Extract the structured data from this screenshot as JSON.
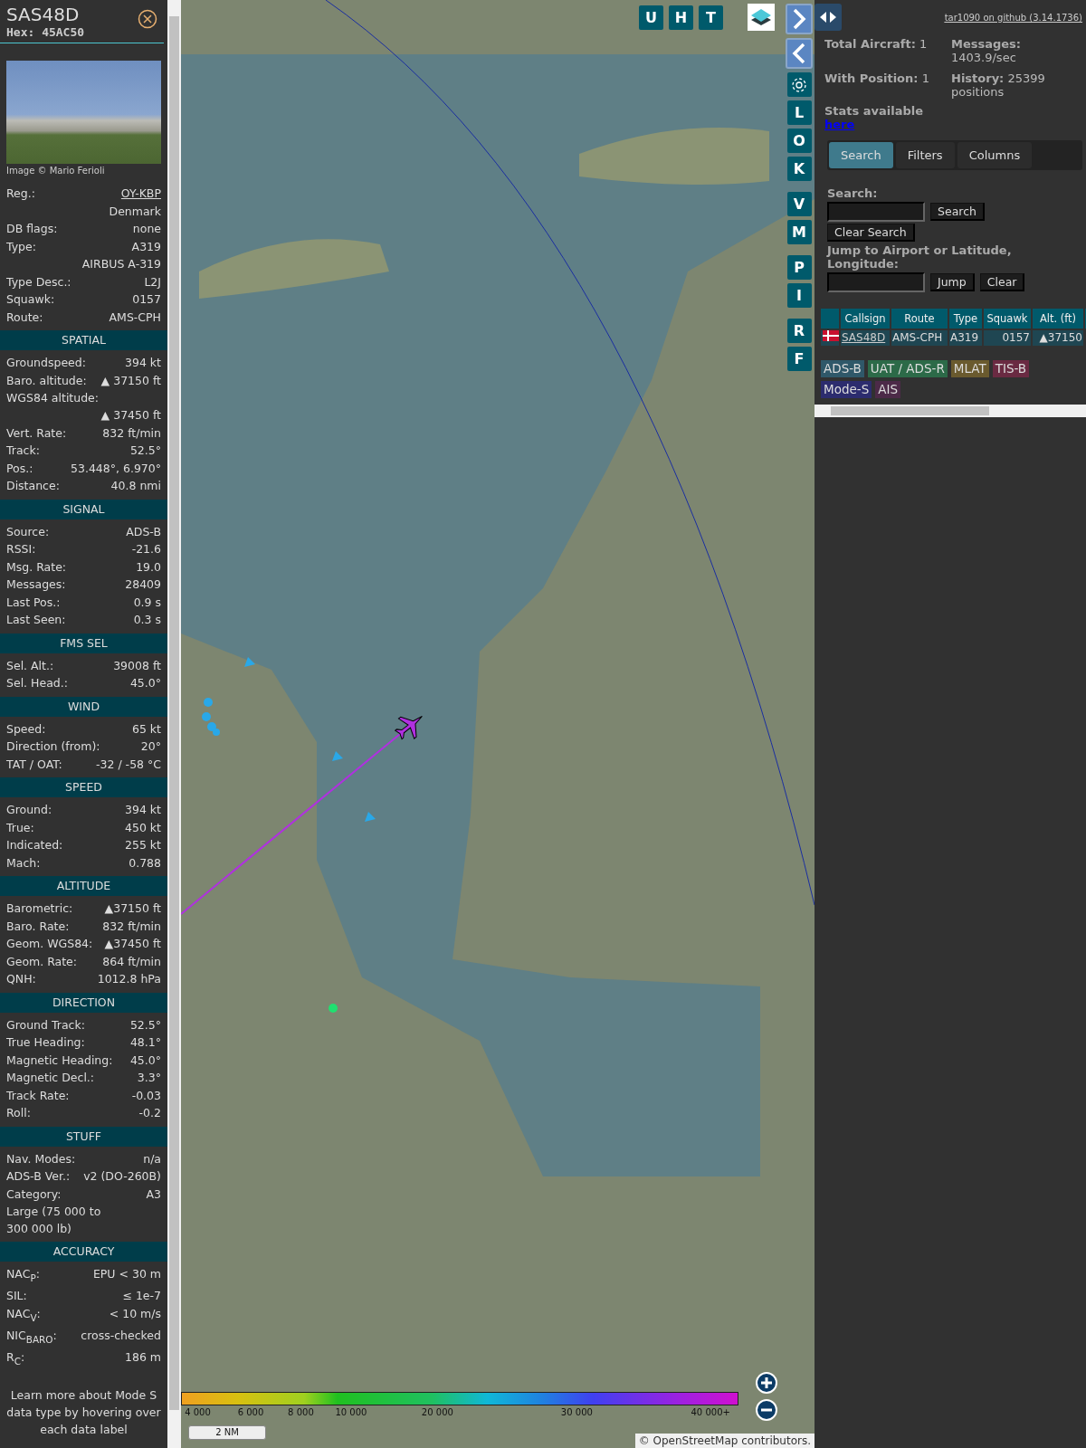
{
  "detail": {
    "callsign": "SAS48D",
    "hex": "Hex: 45AC50",
    "photo_credit": "Image © Mario Ferioli",
    "info_rows": [
      {
        "kind": "link",
        "label": "Reg.:",
        "value": "OY-KBP"
      },
      {
        "kind": "value",
        "value": "Denmark"
      },
      {
        "kind": "pair",
        "label": "DB flags:",
        "value": "none"
      },
      {
        "kind": "pair",
        "label": "Type:",
        "value": "A319"
      },
      {
        "kind": "value",
        "value": "AIRBUS A-319"
      },
      {
        "kind": "pair",
        "label": "Type Desc.:",
        "value": "L2J"
      },
      {
        "kind": "pair",
        "label": "Squawk:",
        "value": "0157"
      },
      {
        "kind": "pair",
        "label": "Route:",
        "value": "AMS-CPH"
      }
    ],
    "sections": [
      {
        "title": "SPATIAL",
        "rows": [
          {
            "kind": "pair",
            "label": "Groundspeed:",
            "value": "394 kt"
          },
          {
            "kind": "pair",
            "label": "Baro. altitude:",
            "value": "▲ 37150 ft"
          },
          {
            "kind": "note",
            "label": "WGS84 altitude:"
          },
          {
            "kind": "value",
            "value": "▲ 37450 ft"
          },
          {
            "kind": "pair",
            "label": "Vert. Rate:",
            "value": "832 ft/min"
          },
          {
            "kind": "pair",
            "label": "Track:",
            "value": "52.5°"
          },
          {
            "kind": "pair",
            "label": "Pos.:",
            "value": "53.448°, 6.970°"
          },
          {
            "kind": "pair",
            "label": "Distance:",
            "value": "40.8 nmi"
          }
        ]
      },
      {
        "title": "SIGNAL",
        "rows": [
          {
            "kind": "pair",
            "label": "Source:",
            "value": "ADS-B"
          },
          {
            "kind": "pair",
            "label": "RSSI:",
            "value": "-21.6"
          },
          {
            "kind": "pair",
            "label": "Msg. Rate:",
            "value": "19.0"
          },
          {
            "kind": "pair",
            "label": "Messages:",
            "value": "28409"
          },
          {
            "kind": "pair",
            "label": "Last Pos.:",
            "value": "0.9 s"
          },
          {
            "kind": "pair",
            "label": "Last Seen:",
            "value": "0.3 s"
          }
        ]
      },
      {
        "title": "FMS SEL",
        "rows": [
          {
            "kind": "pair",
            "label": "Sel. Alt.:",
            "value": "39008 ft"
          },
          {
            "kind": "pair",
            "label": "Sel. Head.:",
            "value": "45.0°"
          }
        ]
      },
      {
        "title": "WIND",
        "rows": [
          {
            "kind": "pair",
            "label": "Speed:",
            "value": "65 kt"
          },
          {
            "kind": "pair",
            "label": "Direction (from):",
            "value": "20°"
          },
          {
            "kind": "pair",
            "label": "TAT / OAT:",
            "value": "-32 / -58 °C"
          }
        ]
      },
      {
        "title": "SPEED",
        "rows": [
          {
            "kind": "pair",
            "label": "Ground:",
            "value": "394 kt"
          },
          {
            "kind": "pair",
            "label": "True:",
            "value": "450 kt"
          },
          {
            "kind": "pair",
            "label": "Indicated:",
            "value": "255 kt"
          },
          {
            "kind": "pair",
            "label": "Mach:",
            "value": "0.788"
          }
        ]
      },
      {
        "title": "ALTITUDE",
        "rows": [
          {
            "kind": "pair",
            "label": "Barometric:",
            "value": "▲37150 ft"
          },
          {
            "kind": "pair",
            "label": "Baro. Rate:",
            "value": "832 ft/min"
          },
          {
            "kind": "pair",
            "label": "Geom. WGS84:",
            "value": "▲37450 ft"
          },
          {
            "kind": "pair",
            "label": "Geom. Rate:",
            "value": "864 ft/min"
          },
          {
            "kind": "pair",
            "label": "QNH:",
            "value": "1012.8 hPa"
          }
        ]
      },
      {
        "title": "DIRECTION",
        "rows": [
          {
            "kind": "pair",
            "label": "Ground Track:",
            "value": "52.5°"
          },
          {
            "kind": "pair",
            "label": "True Heading:",
            "value": "48.1°"
          },
          {
            "kind": "pair",
            "label": "Magnetic Heading:",
            "value": "45.0°"
          },
          {
            "kind": "pair",
            "label": "Magnetic Decl.:",
            "value": "3.3°"
          },
          {
            "kind": "pair",
            "label": "Track Rate:",
            "value": "-0.03"
          },
          {
            "kind": "pair",
            "label": "Roll:",
            "value": "-0.2"
          }
        ]
      },
      {
        "title": "STUFF",
        "rows": [
          {
            "kind": "pair",
            "label": "Nav. Modes:",
            "value": "n/a"
          },
          {
            "kind": "pair",
            "label": "ADS-B Ver.:",
            "value": "v2 (DO-260B)"
          },
          {
            "kind": "pair",
            "label": "Category:",
            "value": "A3"
          },
          {
            "kind": "note",
            "label": "Large (75 000 to 300 000 lb)"
          }
        ]
      },
      {
        "title": "ACCURACY",
        "rows": [
          {
            "kind": "pair",
            "label": "NAC$_{P}$:",
            "value": "EPU < 30 m"
          },
          {
            "kind": "pair",
            "label": "SIL:",
            "value": "≤ 1e-7"
          },
          {
            "kind": "pair",
            "label": "NAC$_{V}$:",
            "value": "< 10 m/s"
          },
          {
            "kind": "pair",
            "label": "NIC$_{BARO}$:",
            "value": "cross-checked"
          },
          {
            "kind": "pair",
            "label": "R$_{C}$:",
            "value": "186 m"
          }
        ]
      }
    ],
    "footer": "Learn more about Mode S data type by hovering over each data label"
  },
  "map": {
    "top_buttons": [
      "U",
      "H",
      "T"
    ],
    "letter_groups": [
      [
        "L",
        "O",
        "K"
      ],
      [
        "V",
        "M"
      ],
      [
        "P",
        "I"
      ],
      [
        "R",
        "F"
      ]
    ],
    "altitude_legend": [
      "4 000",
      "6 000",
      "8 000",
      "10 000",
      "20 000",
      "30 000",
      "40 000+"
    ],
    "scale": "2 NM",
    "attribution": "© OpenStreetMap contributors."
  },
  "sidebar": {
    "github_link": "tar1090 on github (3.14.1736)",
    "stats": [
      {
        "label": "Total Aircraft:",
        "value": "1"
      },
      {
        "label": "Messages:",
        "value": "1403.9/sec"
      },
      {
        "label": "With Position:",
        "value": "1"
      },
      {
        "label": "History:",
        "value": "25399 positions"
      }
    ],
    "stats_note": "Stats available",
    "stats_link": "here",
    "tabs": [
      {
        "label": "Search",
        "selected": true
      },
      {
        "label": "Filters",
        "selected": false
      },
      {
        "label": "Columns",
        "selected": false
      }
    ],
    "search_label": "Search:",
    "search_button": "Search",
    "clear_search_button": "Clear Search",
    "jump_label": "Jump to Airport or Latitude, Longitude:",
    "jump_button": "Jump",
    "clear_button": "Clear",
    "table": {
      "columns": [
        "Callsign",
        "Route",
        "Type",
        "Squawk",
        "Alt. (ft)"
      ],
      "rows": [
        {
          "callsign": "SAS48D",
          "route": "AMS-CPH",
          "type": "A319",
          "squawk": "0157",
          "altitude": "▲37150"
        }
      ]
    },
    "source_tags": [
      {
        "label": "ADS-B",
        "color": "#2f5869"
      },
      {
        "label": "UAT / ADS-R",
        "color": "#2c6a48"
      },
      {
        "label": "MLAT",
        "color": "#6a5a2e"
      },
      {
        "label": "TIS-B",
        "color": "#6a2a42"
      },
      {
        "label": "Mode-S",
        "color": "#2c2c6e"
      },
      {
        "label": "AIS",
        "color": "#4c2a48"
      }
    ]
  }
}
